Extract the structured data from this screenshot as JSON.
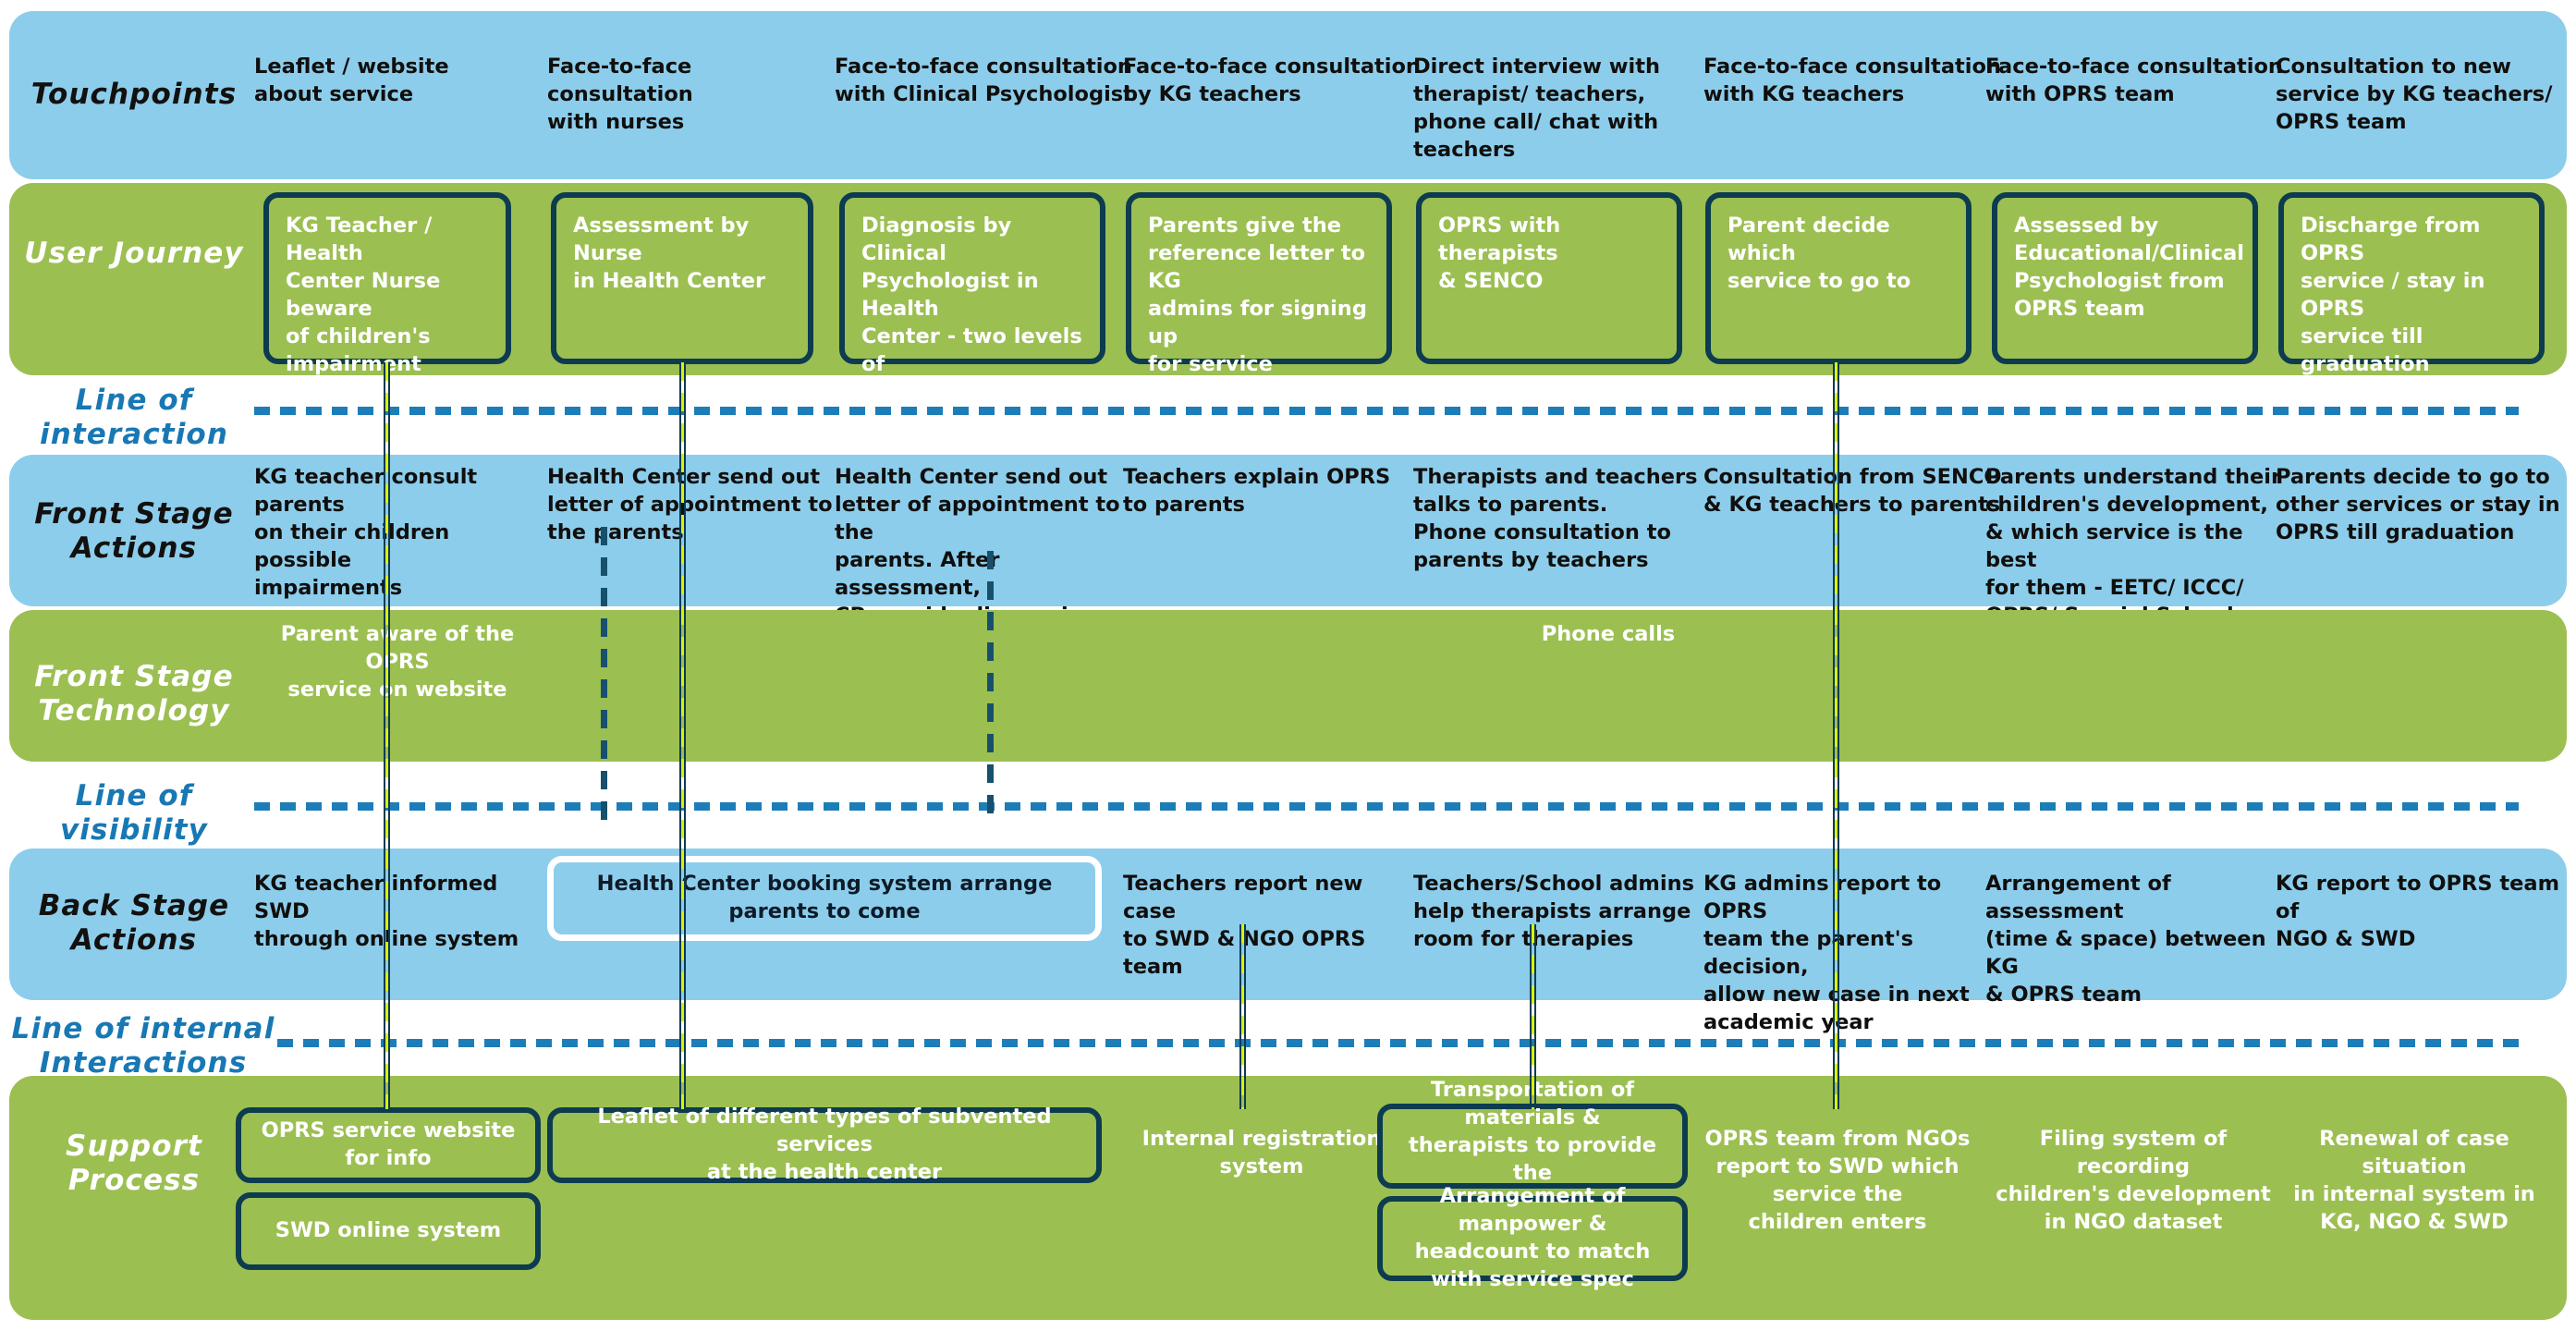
{
  "colors": {
    "blue_band": "#8dcdec",
    "green_band": "#9cbf52",
    "outline": "#0d3b4f",
    "dashed_line": "#1d7db8",
    "connector_yellow": "#d9f20a",
    "label_sep": "#1878b4"
  },
  "rows": {
    "touchpoints": {
      "label": "Touchpoints"
    },
    "user_journey": {
      "label": "User Journey"
    },
    "line_of_interaction": {
      "label": "Line of\ninteraction"
    },
    "front_stage_actions": {
      "label": "Front Stage\nActions"
    },
    "front_stage_technology": {
      "label": "Front Stage\nTechnology"
    },
    "line_of_visibility": {
      "label": "Line of\nvisibility"
    },
    "back_stage_actions": {
      "label": "Back Stage\nActions"
    },
    "line_of_internal_interactions": {
      "label": "Line of internal\nInteractions"
    },
    "support_process": {
      "label": "Support\nProcess"
    }
  },
  "touchpoints": [
    "Leaflet / website\nabout service",
    "Face-to-face consultation\nwith nurses",
    "Face-to-face consultation\nwith Clinical Psychologist",
    "Face-to-face consultation\nby KG teachers",
    "Direct interview with\ntherapist/ teachers,\nphone call/ chat with\nteachers",
    "Face-to-face consultation\nwith KG teachers",
    "Face-to-face consultation\nwith OPRS team",
    "Consultation to new\nservice by KG teachers/\nOPRS team"
  ],
  "user_journey": [
    "KG Teacher / Health\nCenter Nurse beware\nof children's\nimpairment",
    "Assessment by Nurse\nin Health Center",
    "Diagnosis by Clinical\nPsychologist in Health\nCenter - two levels of\nimpairment, &\nsubvented services",
    "Parents give the\nreference letter to KG\nadmins for signing up\nfor service",
    "OPRS with therapists\n& SENCO",
    "Parent decide which\nservice to go to",
    "Assessed by\nEducational/Clinical\nPsychologist from\nOPRS team",
    "Discharge from OPRS\nservice / stay in OPRS\nservice till graduation"
  ],
  "front_stage_actions": [
    "KG teacher consult parents\non their children possible\nimpairments",
    "Health Center send out\nletter of appointment to\nthe parents",
    "Health Center send out\nletter of appointment to the\nparents. After assessment,\nCP provide diagnosis proof\n& reference letter",
    "Teachers explain OPRS\nto parents",
    "Therapists and teachers\ntalks to parents.\nPhone consultation to\nparents by teachers",
    "Consultation from SENCO\n& KG teachers to parents",
    "Parents understand their\nchildren's development,\n& which service is the best\nfor them - EETC/ ICCC/\nOPRS/ Special School",
    "Parents decide to go to\nother services or stay in\nOPRS till graduation"
  ],
  "front_stage_technology": [
    {
      "text": "Parent aware of the OPRS\nservice on website"
    },
    {
      "text": "Phone calls"
    }
  ],
  "back_stage_actions": {
    "plain": [
      "KG teacher informed SWD\nthrough online system",
      "Teachers report new case\nto SWD & NGO OPRS team",
      "Teachers/School admins\nhelp therapists arrange\nroom for therapies",
      "KG admins report to OPRS\nteam the parent's decision,\nallow new case in next\nacademic year",
      "Arrangement of assessment\n(time & space) between KG\n& OPRS team",
      "KG report to OPRS team of\nNGO & SWD"
    ],
    "boxed": [
      "Health Center booking system arrange\nparents to come"
    ]
  },
  "support_process": {
    "boxed": [
      "OPRS service website\nfor info",
      "Leaflet of different types of subvented services\nat the health center",
      "SWD online system",
      "Transportation of materials &\ntherapists to provide the\nservice",
      "Arrangement of manpower &\nheadcount to match\nwith service spec"
    ],
    "plain": [
      "Internal registration\nsystem",
      "OPRS team from NGOs\nreport to SWD which\nservice the\nchildren enters",
      "Filing system of recording\nchildren's development\nin NGO dataset",
      "Renewal of case situation\nin internal system in\nKG, NGO & SWD"
    ]
  }
}
